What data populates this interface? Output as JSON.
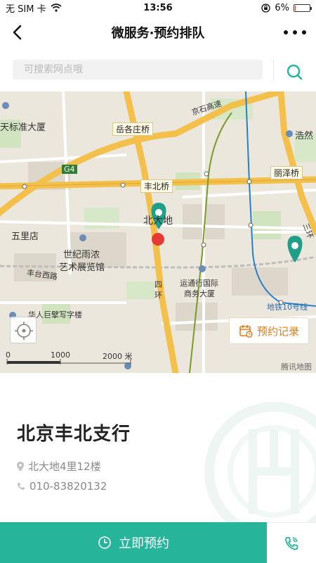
{
  "status_bar": {
    "carrier": "无 SIM 卡",
    "time": "13:56",
    "battery": "6%",
    "battery_level": 0.06,
    "icons": [
      "wifi-icon",
      "orientation-lock-icon",
      "battery-icon"
    ]
  },
  "nav": {
    "title": "微服务·预约排队",
    "back_icon": "chevron-left-icon",
    "more_icon": "more-dots-icon"
  },
  "search": {
    "placeholder": "可搜索网点哦",
    "value": "",
    "icon": "search-icon"
  },
  "map": {
    "labels": {
      "tianshui": "天标准大厦",
      "yuegezhuang": "岳各庄桥",
      "jingjing": "京石高速",
      "haode": "浩然",
      "g4": "G4",
      "fengbei_bridge": "丰北桥",
      "lize_bridge": "丽泽桥",
      "wulidian": "五里店",
      "beidadi": "北大地",
      "shiji": "世纪雨浓",
      "art_hall": "艺术展览馆",
      "fengtai_west": "丰台西路",
      "si": "四",
      "huan": "环",
      "yunda": "运通行国际",
      "business": "商务大厦",
      "huaren": "华人巨擘写字楼",
      "subway": "地铁10号线",
      "sanhuan": "三环",
      "watermark": "腾讯地图"
    },
    "scale_labels": [
      "0",
      "1000",
      "2000 米"
    ],
    "records_label": "预约记录",
    "locate_icon": "crosshair-icon",
    "records_icon": "calendar-clock-icon",
    "colors": {
      "accent": "#26b59a",
      "marker": "#1f9e8a",
      "current_location": "#e53935",
      "highway": "#f2c04b",
      "subway": "#2a7fc9",
      "rail": "#7a9a2a"
    }
  },
  "branch": {
    "name": "北京丰北支行",
    "address": "北大地4里12楼",
    "phone": "010-83820132",
    "address_icon": "location-pin-icon",
    "phone_icon": "phone-icon"
  },
  "footer": {
    "book_label": "立即预约",
    "book_icon": "clock-icon",
    "call_icon": "phone-call-icon"
  }
}
